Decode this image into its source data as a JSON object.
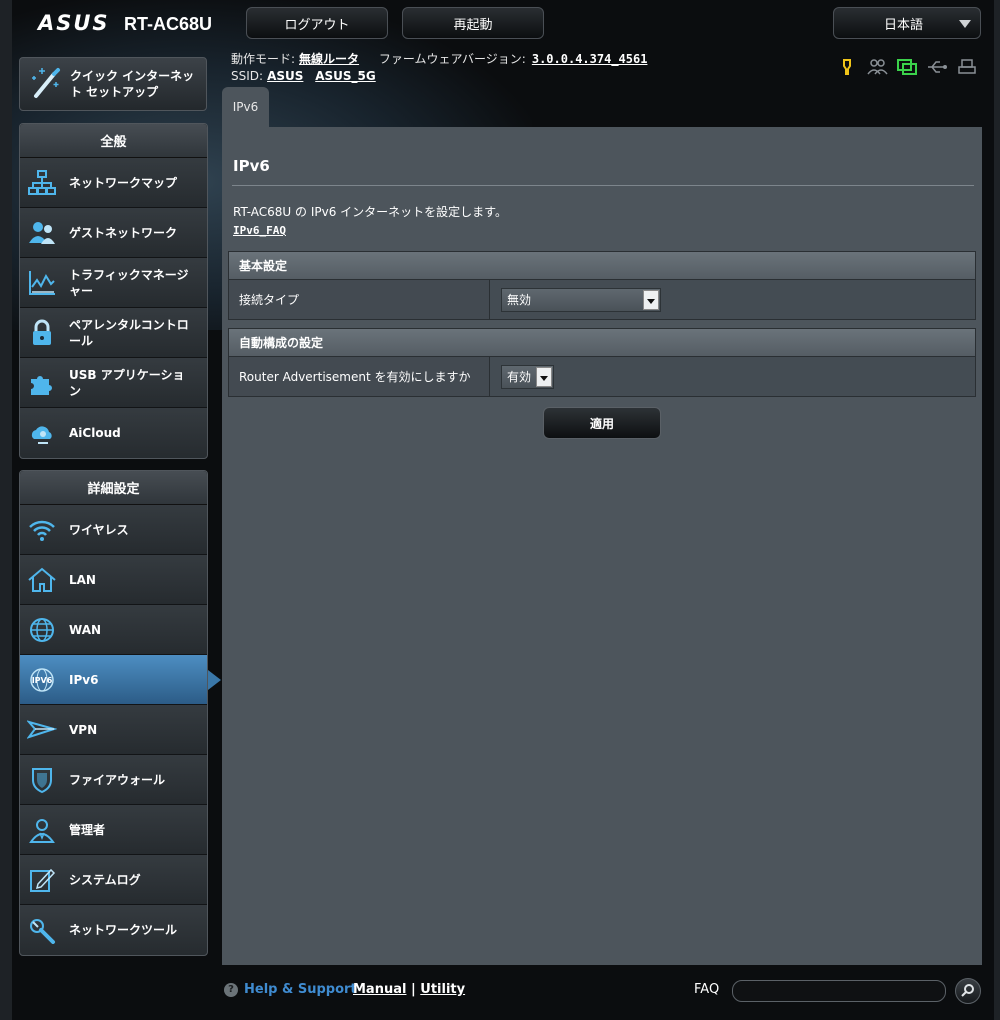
{
  "header": {
    "logo": "ASUS",
    "model": "RT-AC68U",
    "logout_label": "ログアウト",
    "reboot_label": "再起動",
    "language": "日本語"
  },
  "status": {
    "mode_label": "動作モード:",
    "mode_value": "無線ルータ",
    "firmware_label": "ファームウェアバージョン:",
    "firmware_value": "3.0.0.4.374_4561",
    "ssid_label": "SSID:",
    "ssid_1": "ASUS",
    "ssid_2": "ASUS_5G"
  },
  "quick_setup": {
    "label": "クイック インターネット セットアップ"
  },
  "general": {
    "title": "全般",
    "items": [
      {
        "label": "ネットワークマップ",
        "icon": "network-map-icon"
      },
      {
        "label": "ゲストネットワーク",
        "icon": "guest-network-icon"
      },
      {
        "label": "トラフィックマネージャー",
        "icon": "traffic-manager-icon"
      },
      {
        "label": "ペアレンタルコントロール",
        "icon": "parental-control-icon"
      },
      {
        "label": "USB アプリケーション",
        "icon": "usb-application-icon"
      },
      {
        "label": "AiCloud",
        "icon": "aicloud-icon"
      }
    ]
  },
  "advanced": {
    "title": "詳細設定",
    "items": [
      {
        "label": "ワイヤレス",
        "icon": "wireless-icon"
      },
      {
        "label": "LAN",
        "icon": "lan-icon"
      },
      {
        "label": "WAN",
        "icon": "wan-icon"
      },
      {
        "label": "IPv6",
        "icon": "ipv6-icon"
      },
      {
        "label": "VPN",
        "icon": "vpn-icon"
      },
      {
        "label": "ファイアウォール",
        "icon": "firewall-icon"
      },
      {
        "label": "管理者",
        "icon": "admin-icon"
      },
      {
        "label": "システムログ",
        "icon": "system-log-icon"
      },
      {
        "label": "ネットワークツール",
        "icon": "network-tools-icon"
      }
    ]
  },
  "main": {
    "tab": "IPv6",
    "title": "IPv6",
    "description": "RT-AC68U の IPv6 インターネットを設定します。",
    "faq_link": "IPv6_FAQ",
    "basic": {
      "header": "基本設定",
      "connection_type_label": "接続タイプ",
      "connection_type_value": "無効"
    },
    "autoconf": {
      "header": "自動構成の設定",
      "router_adv_label": "Router Advertisement を有効にしますか",
      "router_adv_value": "有効"
    },
    "apply_label": "適用"
  },
  "footer": {
    "help_label": "Help & Support",
    "manual_label": "Manual",
    "separator": "|",
    "utility_label": "Utility",
    "faq_label": "FAQ"
  },
  "colors": {
    "accent": "#3a77a8",
    "panel": "#4d555c",
    "help_link": "#3f8bd0",
    "icon_blue": "#4fb6ec",
    "led_yellow": "#f0c419",
    "led_green": "#3bd24b"
  }
}
